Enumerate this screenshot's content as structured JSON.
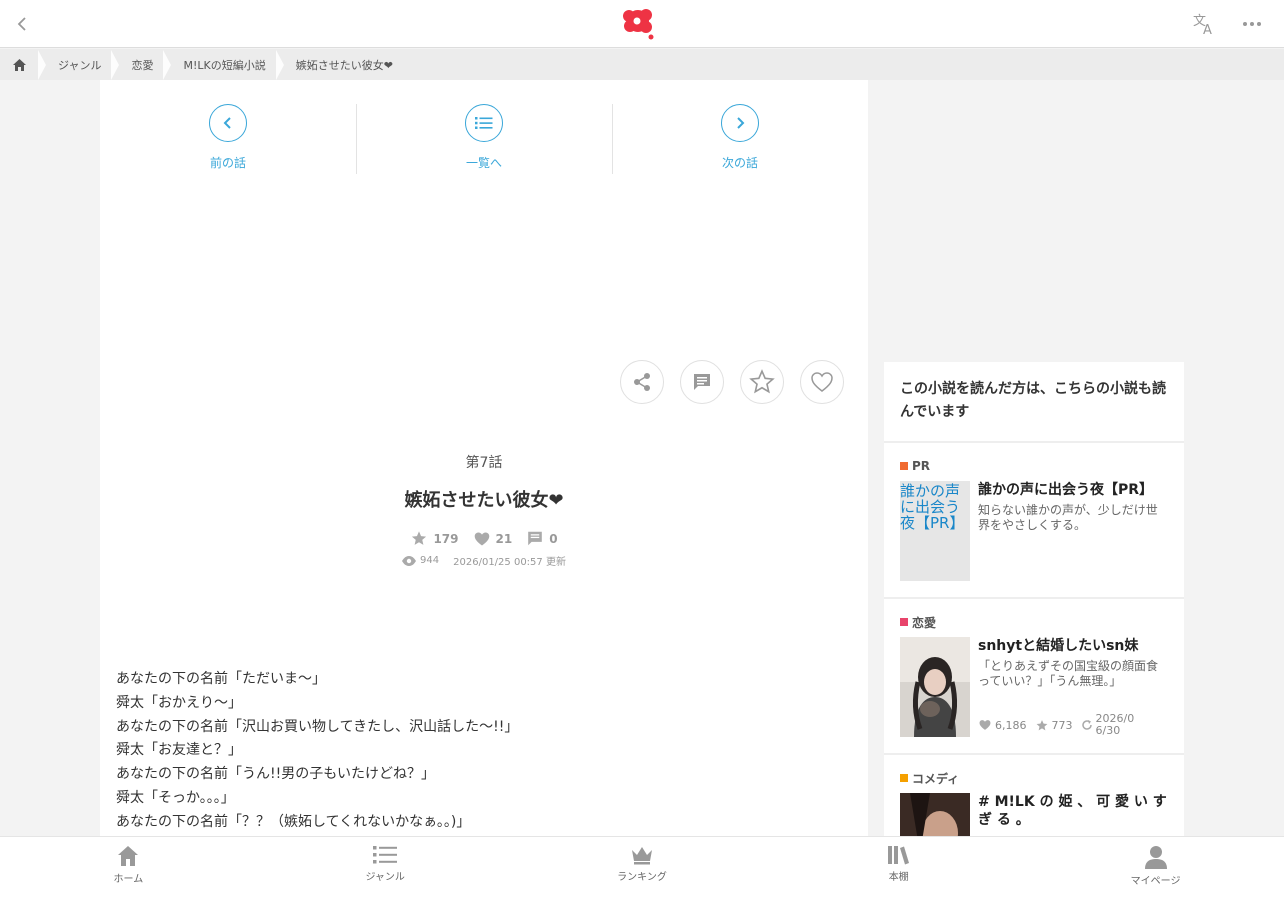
{
  "header": {
    "back_icon": "chevron-left-icon",
    "logo": "brand-logo",
    "translate_icon": "translate-icon",
    "more_icon": "more-horizontal-icon"
  },
  "breadcrumb": {
    "items": [
      "ジャンル",
      "恋愛",
      "M!LKの短編小説",
      "嫉妬させたい彼女❤︎"
    ]
  },
  "episode_nav": {
    "prev": "前の話",
    "list": "一覧へ",
    "next": "次の話"
  },
  "episode": {
    "number": "第7話",
    "title": "嫉妬させたい彼女❤︎",
    "stars": "179",
    "likes": "21",
    "comments": "0",
    "views": "944",
    "updated": "2026/01/25 00:57 更新"
  },
  "body_lines": [
    "あなたの下の名前「ただいま〜」",
    "舜太「おかえり〜」",
    "あなたの下の名前「沢山お買い物してきたし、沢山話した〜!!」",
    "舜太「お友達と？」",
    "あなたの下の名前「うん!!男の子もいたけどね？」",
    "舜太「そっか。。。」",
    "あなたの下の名前「？？（嫉妬してくれないかなぁ。。)」"
  ],
  "sidebar": {
    "heading": "この小説を読んだ方は、こちらの小説も読んでいます",
    "items": [
      {
        "tag": "PR",
        "tag_color": "#f06a30",
        "thumb_alt": "誰かの声に出会う夜【PR】",
        "title": "誰かの声に出会う夜【PR】",
        "desc": "知らない誰かの声が、少しだけ世界をやさしくする。"
      },
      {
        "tag": "恋愛",
        "tag_color": "#e8446b",
        "title": "snhytと結婚したいsn妹",
        "desc": "「とりあえずその国宝級の顔面食っていい？」「うん無理。」",
        "likes": "6,186",
        "stars": "773",
        "updated": "2026/06/30"
      },
      {
        "tag": "コメディ",
        "tag_color": "#f5a000",
        "title": "# M!LK の 姫 、 可 愛 い す ぎ る 。"
      }
    ]
  },
  "bottom_nav": {
    "home": "ホーム",
    "genre": "ジャンル",
    "ranking": "ランキング",
    "shelf": "本棚",
    "mypage": "マイページ"
  },
  "colors": {
    "accent": "#3aa7d9",
    "brand": "#ee3344"
  }
}
